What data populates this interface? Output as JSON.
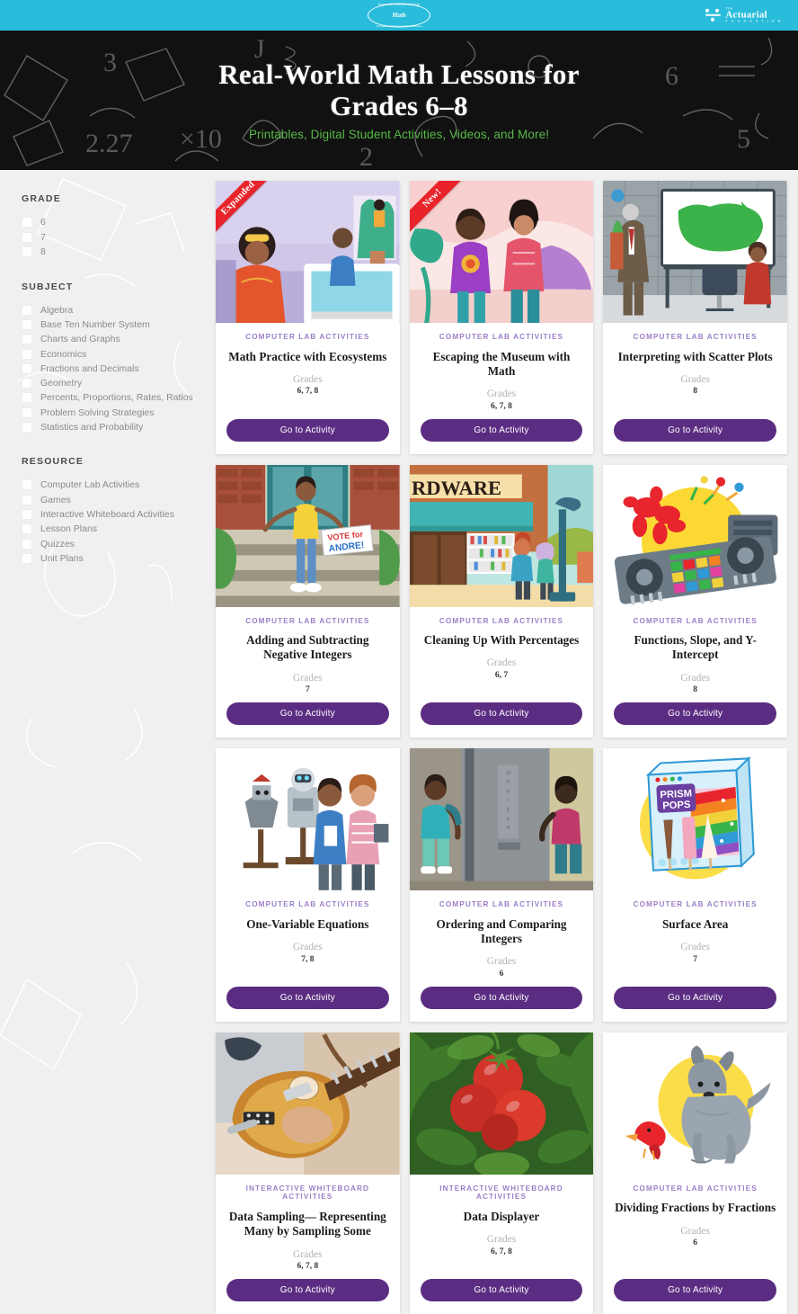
{
  "topbar": {
    "brand": {
      "arc_top": "Expect the Unexpected with",
      "word": "Math",
      "arc_bottom": "A Program of The Actuarial Foundation"
    },
    "partner": {
      "the": "The",
      "name": "Actuarial",
      "sub": "F O U N D A T I O N"
    }
  },
  "hero": {
    "title_line1": "Real-World Math Lessons for",
    "title_line2": "Grades 6–8",
    "subtitle": "Printables, Digital Student Activities, Videos, and More!"
  },
  "filters": [
    {
      "title": "GRADE",
      "name": "grade",
      "options": [
        "6",
        "7",
        "8"
      ]
    },
    {
      "title": "SUBJECT",
      "name": "subject",
      "options": [
        "Algebra",
        "Base Ten Number System",
        "Charts and Graphs",
        "Economics",
        "Fractions and Decimals",
        "Geometry",
        "Percents, Proportions, Rates, Ratios",
        "Problem Solving Strategies",
        "Statistics and Probability"
      ]
    },
    {
      "title": "RESOURCE",
      "name": "resource",
      "options": [
        "Computer Lab Activities",
        "Games",
        "Interactive Whiteboard Activities",
        "Lesson Plans",
        "Quizzes",
        "Unit Plans"
      ]
    }
  ],
  "labels": {
    "grades": "Grades",
    "cta": "Go to Activity"
  },
  "colors": {
    "teal": "#29bcdb",
    "purple": "#5b2d82",
    "kicker_purple": "#9b7fc7",
    "green": "#57b947",
    "ribbon_red": "#e8242a",
    "page_bg": "#f0f0f0"
  },
  "cards": [
    {
      "ribbon": "Expanded",
      "kicker": "COMPUTER LAB ACTIVITIES",
      "title": "Math Practice with Ecosystems",
      "grades": "6, 7, 8",
      "art": "ecosystems"
    },
    {
      "ribbon": "New!",
      "kicker": "COMPUTER LAB ACTIVITIES",
      "title": "Escaping the Museum with Math",
      "grades": "6, 7, 8",
      "art": "museum"
    },
    {
      "ribbon": "",
      "kicker": "COMPUTER LAB ACTIVITIES",
      "title": "Interpreting with Scatter Plots",
      "grades": "8",
      "art": "classroom-map"
    },
    {
      "ribbon": "",
      "kicker": "COMPUTER LAB ACTIVITIES",
      "title": "Adding and Subtracting Negative Integers",
      "grades": "7",
      "art": "vote-andre"
    },
    {
      "ribbon": "",
      "kicker": "COMPUTER LAB ACTIVITIES",
      "title": "Cleaning Up With Percentages",
      "grades": "6, 7",
      "art": "hardware-store"
    },
    {
      "ribbon": "",
      "kicker": "COMPUTER LAB ACTIVITIES",
      "title": "Functions, Slope, and Y-Intercept",
      "grades": "8",
      "art": "dj-mixer"
    },
    {
      "ribbon": "",
      "kicker": "COMPUTER LAB ACTIVITIES",
      "title": "One-Variable Equations",
      "grades": "7, 8",
      "art": "robot-students"
    },
    {
      "ribbon": "",
      "kicker": "COMPUTER LAB ACTIVITIES",
      "title": "Ordering and Comparing Integers",
      "grades": "6",
      "art": "elevator"
    },
    {
      "ribbon": "",
      "kicker": "COMPUTER LAB ACTIVITIES",
      "title": "Surface Area",
      "grades": "7",
      "art": "prism-pops"
    },
    {
      "ribbon": "",
      "kicker": "INTERACTIVE WHITEBOARD ACTIVITIES",
      "title": "Data Sampling— Representing Many by Sampling Some",
      "grades": "6, 7, 8",
      "art": "guitar-photo"
    },
    {
      "ribbon": "",
      "kicker": "INTERACTIVE WHITEBOARD ACTIVITIES",
      "title": "Data Displayer",
      "grades": "6, 7, 8",
      "art": "tomatoes-photo"
    },
    {
      "ribbon": "",
      "kicker": "COMPUTER LAB ACTIVITIES",
      "title": "Dividing Fractions by Fractions",
      "grades": "6",
      "art": "dog-bird"
    }
  ]
}
